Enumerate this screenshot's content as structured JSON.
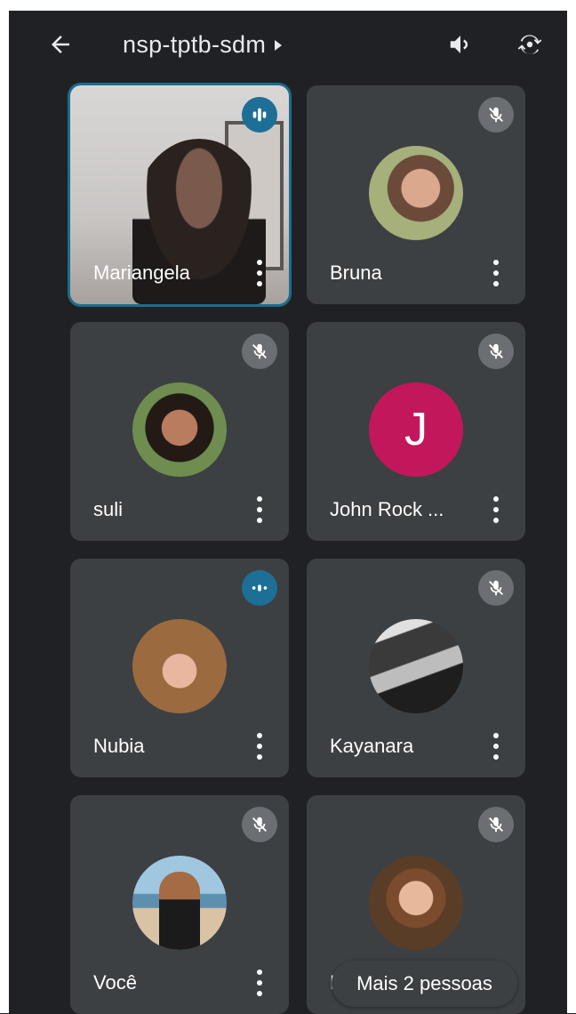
{
  "header": {
    "meeting_code": "nsp-tptb-sdm",
    "icons": [
      "back-arrow-icon",
      "caret-right-icon",
      "speaker-icon",
      "switch-camera-icon"
    ]
  },
  "participants": [
    {
      "name": "Mariangela",
      "mic": "speaking",
      "media": "video",
      "active": true
    },
    {
      "name": "Bruna",
      "mic": "muted",
      "media": "photo"
    },
    {
      "name": "suli",
      "mic": "muted",
      "media": "photo"
    },
    {
      "name": "John Rock ...",
      "mic": "muted",
      "media": "letter",
      "initial": "J",
      "avatar_color": "#c2185b"
    },
    {
      "name": "Nubia",
      "mic": "speaking",
      "media": "photo"
    },
    {
      "name": "Kayanara",
      "mic": "muted",
      "media": "photo"
    },
    {
      "name": "Você",
      "mic": "muted",
      "media": "photo"
    },
    {
      "name": "Le",
      "mic": "muted",
      "media": "photo"
    }
  ],
  "more_people_label": "Mais 2 pessoas",
  "colors": {
    "background": "#202124",
    "tile": "#3c4043",
    "speaking_badge": "#1d6f96",
    "muted_badge": "#6b6e72"
  }
}
